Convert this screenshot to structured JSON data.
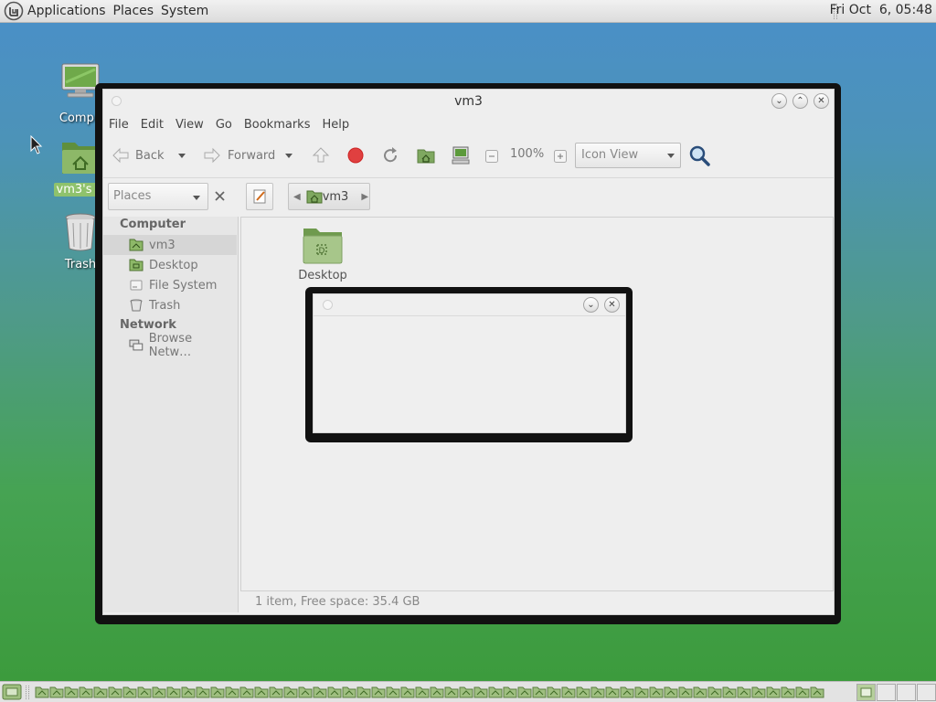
{
  "top_panel": {
    "menus": [
      "Applications",
      "Places",
      "System"
    ],
    "clock": "Fri Oct  6, 05:48"
  },
  "desktop_icons": [
    {
      "label": "Compu"
    },
    {
      "label": "vm3's H"
    },
    {
      "label": "Trash"
    }
  ],
  "window": {
    "title": "vm3",
    "menu": [
      "File",
      "Edit",
      "View",
      "Go",
      "Bookmarks",
      "Help"
    ],
    "toolbar": {
      "back": "Back",
      "forward": "Forward",
      "zoom": "100%",
      "view_mode": "Icon View"
    },
    "location": {
      "places_combo": "Places",
      "breadcrumb": "vm3"
    },
    "sidebar": {
      "computer_header": "Computer",
      "computer_items": [
        "vm3",
        "Desktop",
        "File System",
        "Trash"
      ],
      "network_header": "Network",
      "network_items": [
        "Browse Netw…"
      ]
    },
    "files": [
      {
        "name": "Desktop"
      }
    ],
    "status": "1 item, Free space: 35.4 GB"
  },
  "colors": {
    "accent": "#8fc26c",
    "folder_green": "#9fbf80"
  }
}
